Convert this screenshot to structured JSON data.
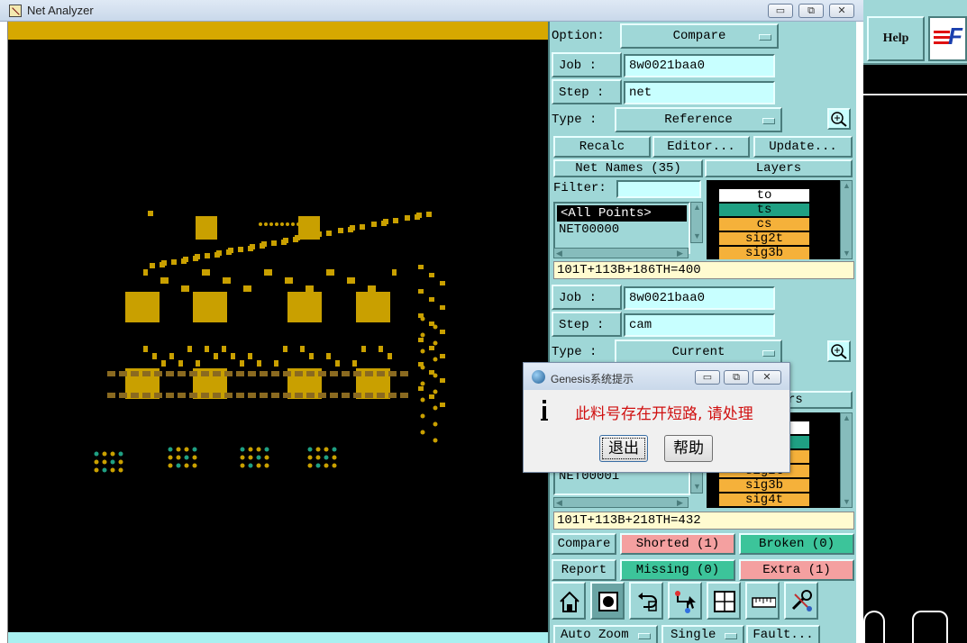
{
  "window": {
    "title": "Net Analyzer",
    "min": "▭",
    "max": "⧉",
    "close": "✕"
  },
  "right": {
    "help": "Help",
    "logo": "F"
  },
  "panel": {
    "option_label": "Option:",
    "option_value": "Compare",
    "job_label": "Job :",
    "job1_value": "8w0021baa0",
    "step_label": "Step :",
    "step1_value": "net",
    "type_label": "Type :",
    "type1_value": "Reference",
    "recalc": "Recalc",
    "editor": "Editor...",
    "update": "Update...",
    "net_names": "Net Names (35)",
    "layers_header": "Layers",
    "filter_label": "Filter:",
    "nets1": [
      "<All Points>",
      "NET00000"
    ],
    "layers1": [
      {
        "name": "to",
        "color": "#ffffff"
      },
      {
        "name": "ts",
        "color": "#1fa083"
      },
      {
        "name": "cs",
        "color": "#f5b13a"
      },
      {
        "name": "sig2t",
        "color": "#f5b13a"
      },
      {
        "name": "sig3b",
        "color": "#f5b13a"
      }
    ],
    "stat1": "101T+113B+186TH=400",
    "job2_value": "8w0021baa0",
    "step2_value": "cam",
    "type2_value": "Current",
    "layers_header2_partial": "rs",
    "nets2": [
      "NET00001"
    ],
    "layers2": [
      {
        "name": "",
        "color": "#ffffff"
      },
      {
        "name": "",
        "color": "#1fa083"
      },
      {
        "name": "",
        "color": "#f5b13a"
      },
      {
        "name": "sig2t",
        "color": "#f5b13a"
      },
      {
        "name": "sig3b",
        "color": "#f5b13a"
      },
      {
        "name": "sig4t",
        "color": "#f5b13a"
      }
    ],
    "stat2": "101T+113B+218TH=432",
    "compare": "Compare",
    "report": "Report",
    "shorted": "Shorted (1)",
    "broken": "Broken (0)",
    "missing": "Missing (0)",
    "extra": "Extra (1)",
    "auto_zoom": "Auto Zoom",
    "single": "Single",
    "fault": "Fault...",
    "colors": {
      "shorted": "#f4a0a0",
      "broken": "#3cc49a",
      "missing": "#3cc49a",
      "extra": "#f4a0a0"
    },
    "icons": [
      "home-icon",
      "board-icon",
      "undo-icon",
      "route-icon",
      "grid-icon",
      "ruler-icon",
      "tools-icon"
    ]
  },
  "dialog": {
    "title": "Genesis系统提示",
    "message": "此料号存在开短路, 请处理",
    "exit": "退出",
    "help": "帮助"
  }
}
